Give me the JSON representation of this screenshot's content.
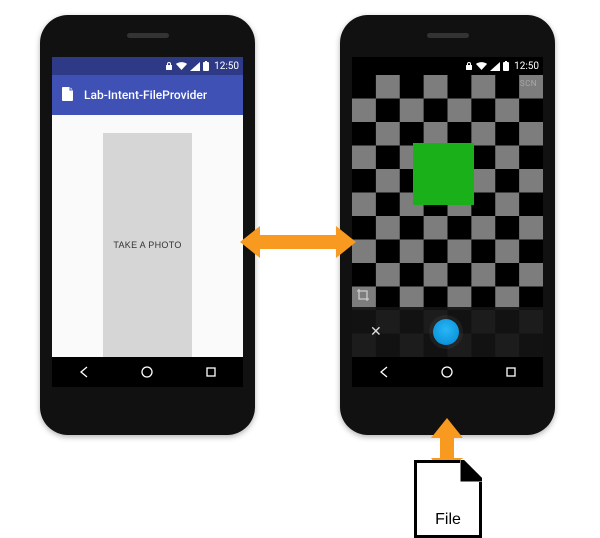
{
  "left_phone": {
    "statusbar": {
      "time": "12:50"
    },
    "appbar": {
      "title": "Lab-Intent-FileProvider"
    },
    "button": {
      "label": "TAKE A PHOTO"
    }
  },
  "right_phone": {
    "statusbar": {
      "time": "12:50"
    },
    "camera": {
      "mode_label": "SCN",
      "accent_color": "#1ab01a",
      "shutter_color": "#0288d1"
    }
  },
  "arrows": {
    "between_phones": "bidirectional-horizontal",
    "camera_to_file": "bidirectional-vertical",
    "color": "#f79a1f"
  },
  "file": {
    "label": "File"
  }
}
